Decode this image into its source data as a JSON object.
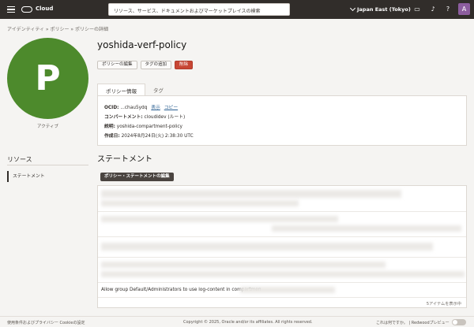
{
  "topbar": {
    "brand": "Cloud",
    "search_placeholder": "リソース、サービス、ドキュメントおよびマーケットプレイスの検索",
    "region": "Japan East (Tokyo)",
    "user_initial": "A"
  },
  "breadcrumb": "アイデンティティ » ポリシー » ポリシーの詳細",
  "policy": {
    "initial": "P",
    "status": "アクティブ",
    "name": "yoshida-verf-policy",
    "buttons": {
      "edit": "ポリシーの編集",
      "add_tag": "タグの追加",
      "delete": "削除"
    },
    "tabs": [
      "ポリシー情報",
      "タグ"
    ],
    "info": {
      "ocid_label": "OCID:",
      "ocid_value": "...chau5ydq",
      "ocid_show": "表示",
      "ocid_copy": "コピー",
      "compartment_label": "コンパートメント:",
      "compartment_value": "cloudidev (ルート)",
      "description_label": "説明:",
      "description_value": "yoshida-compartment-policy",
      "created_label": "作成日:",
      "created_value": "2024年8月24日(火) 2:38:30 UTC"
    }
  },
  "sidebar": {
    "title": "リソース",
    "items": [
      "ステートメント"
    ]
  },
  "statements": {
    "title": "ステートメント",
    "edit_button": "ポリシー・ステートメントの編集",
    "visible_statement": "Allow group Default/Administrators to use log-content in compartmen",
    "count": "5アイテムを表示中"
  },
  "footer": {
    "left": "使用条件およびプライバシー    Cookieの設定",
    "copyright": "Copyright © 2025, Oracle and/or its affiliates. All rights reserved.",
    "right": "これは何ですか。 | Redwoodプレビュー"
  }
}
